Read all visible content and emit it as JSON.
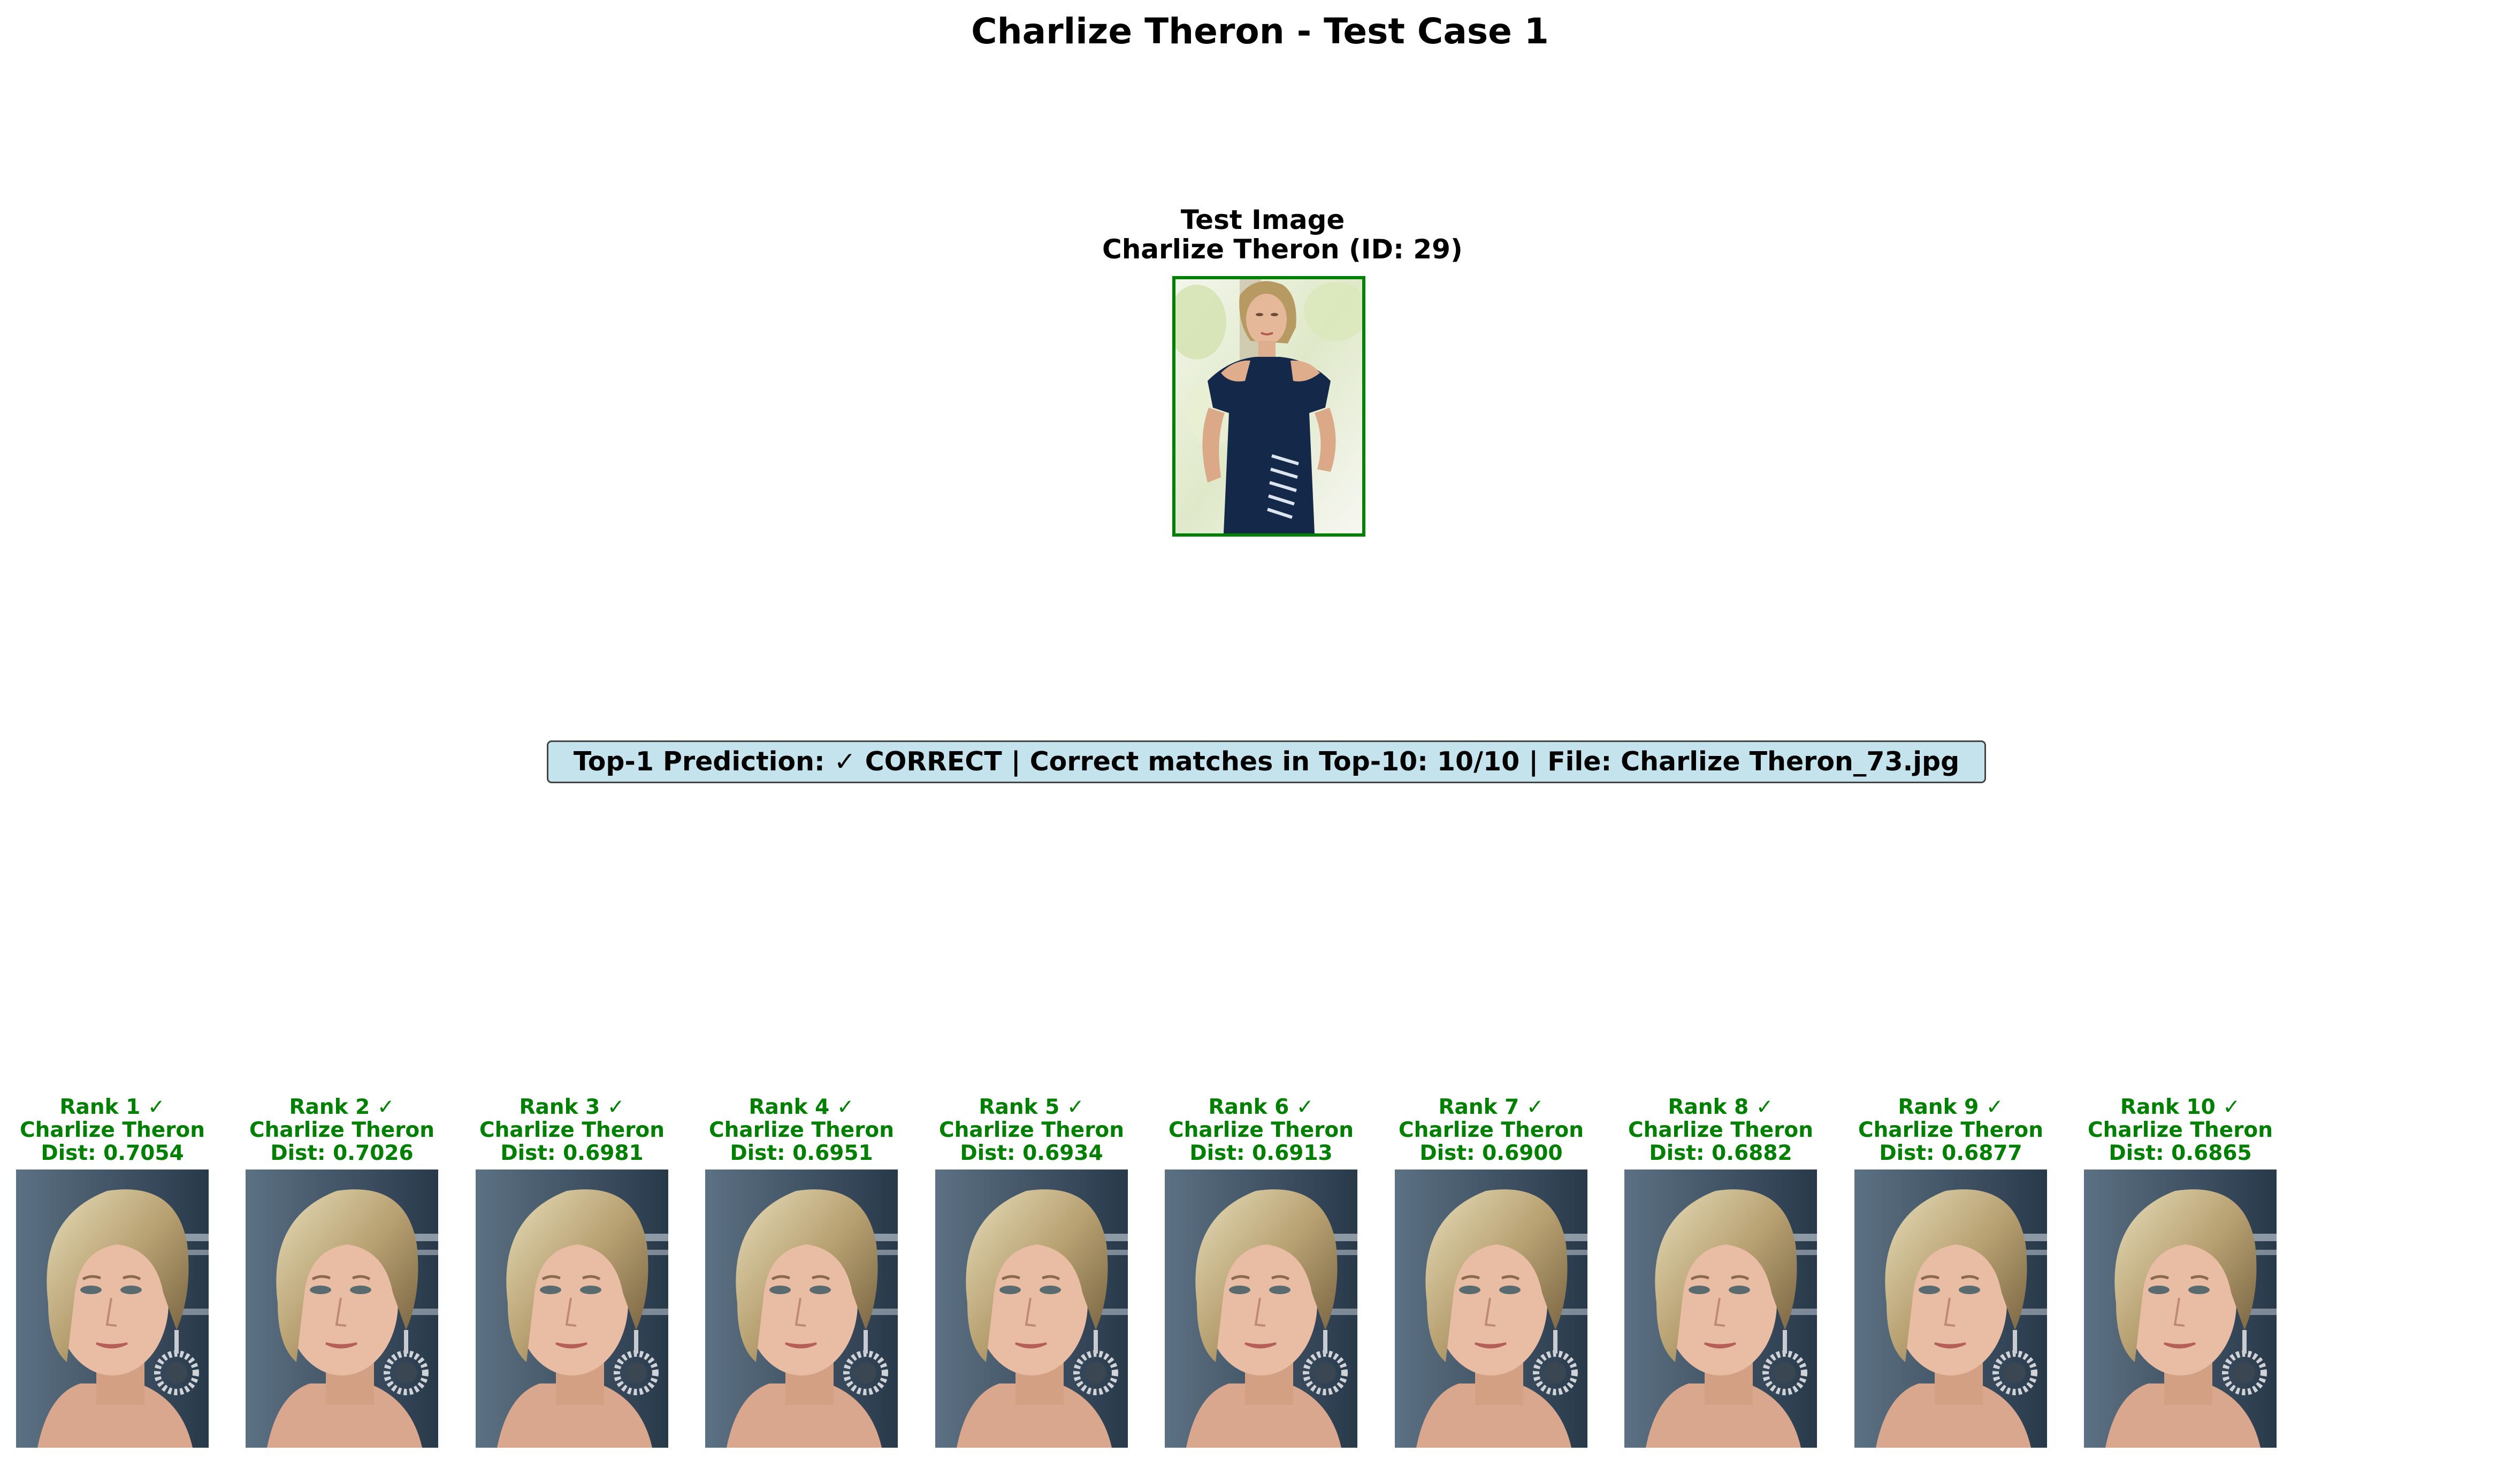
{
  "figure": {
    "title": "Charlize Theron - Test Case 1"
  },
  "test_panel": {
    "title_line1": "Test Image",
    "title_line2": "Charlize Theron (ID: 29)",
    "border_color": "#008000"
  },
  "summary": {
    "text": "Top-1 Prediction: ✓ CORRECT | Correct matches in Top-10: 10/10 | File: Charlize Theron_73.jpg",
    "background": "#c5e3ec"
  },
  "matches": [
    {
      "rank": "Rank 1 ✓",
      "name": "Charlize Theron",
      "dist": "Dist: 0.7054"
    },
    {
      "rank": "Rank 2 ✓",
      "name": "Charlize Theron",
      "dist": "Dist: 0.7026"
    },
    {
      "rank": "Rank 3 ✓",
      "name": "Charlize Theron",
      "dist": "Dist: 0.6981"
    },
    {
      "rank": "Rank 4 ✓",
      "name": "Charlize Theron",
      "dist": "Dist: 0.6951"
    },
    {
      "rank": "Rank 5 ✓",
      "name": "Charlize Theron",
      "dist": "Dist: 0.6934"
    },
    {
      "rank": "Rank 6 ✓",
      "name": "Charlize Theron",
      "dist": "Dist: 0.6913"
    },
    {
      "rank": "Rank 7 ✓",
      "name": "Charlize Theron",
      "dist": "Dist: 0.6900"
    },
    {
      "rank": "Rank 8 ✓",
      "name": "Charlize Theron",
      "dist": "Dist: 0.6882"
    },
    {
      "rank": "Rank 9 ✓",
      "name": "Charlize Theron",
      "dist": "Dist: 0.6877"
    },
    {
      "rank": "Rank 10 ✓",
      "name": "Charlize Theron",
      "dist": "Dist: 0.6865"
    }
  ],
  "colors": {
    "correct": "#008000"
  }
}
